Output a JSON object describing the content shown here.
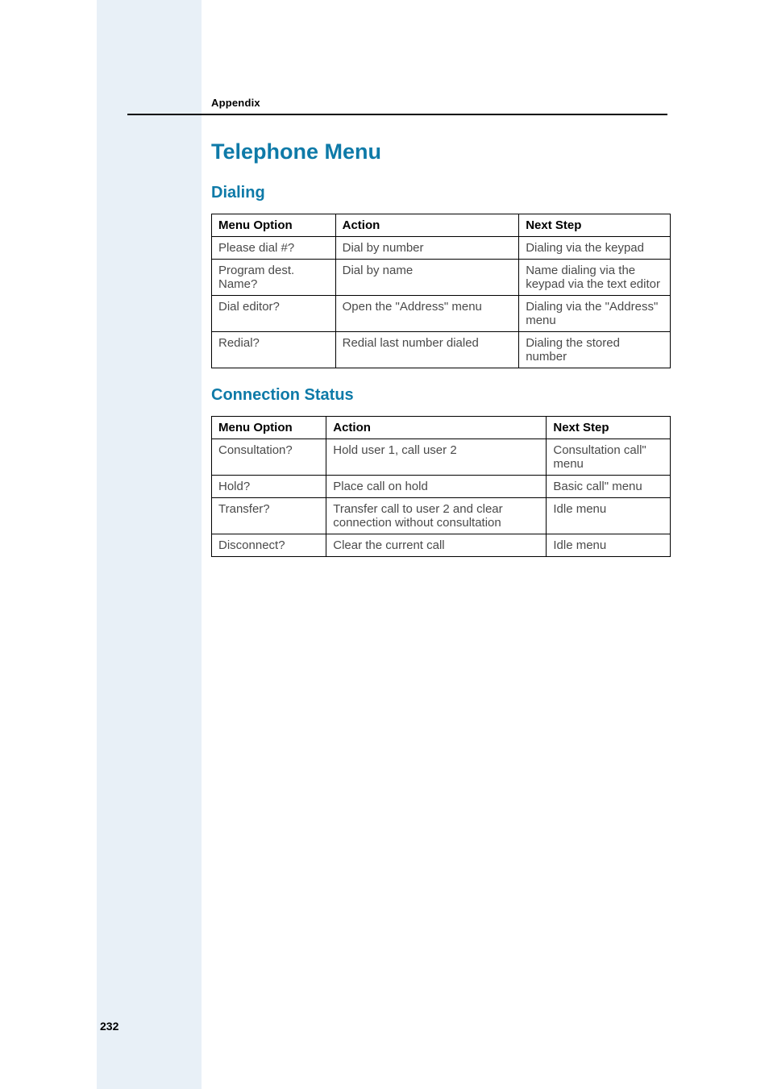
{
  "appendix_label": "Appendix",
  "page_title": "Telephone Menu",
  "sections": {
    "dialing": {
      "heading": "Dialing",
      "headers": {
        "col1": "Menu Option",
        "col2": "Action",
        "col3": "Next Step"
      },
      "rows": [
        {
          "option": "Please dial #?",
          "action": "Dial by number",
          "next": "Dialing via the keypad"
        },
        {
          "option": "Program dest. Name?",
          "action": "Dial by name",
          "next": "Name dialing via the keypad via the text editor"
        },
        {
          "option": "Dial editor?",
          "action": "Open the \"Address\" menu",
          "next": "Dialing via the \"Address\" menu"
        },
        {
          "option": "Redial?",
          "action": "Redial last number dialed",
          "next": "Dialing the stored number"
        }
      ]
    },
    "connection": {
      "heading": "Connection Status",
      "headers": {
        "col1": "Menu Option",
        "col2": "Action",
        "col3": "Next Step"
      },
      "rows": [
        {
          "option": "Consultation?",
          "action": "Hold user 1, call user 2",
          "next": "Consultation call\" menu"
        },
        {
          "option": "Hold?",
          "action": "Place call on hold",
          "next": "Basic call\" menu"
        },
        {
          "option": "Transfer?",
          "action": "Transfer call to user 2 and clear connection without consultation",
          "next": "Idle menu"
        },
        {
          "option": "Disconnect?",
          "action": "Clear the current call",
          "next": "Idle menu"
        }
      ]
    }
  },
  "page_number": "232"
}
